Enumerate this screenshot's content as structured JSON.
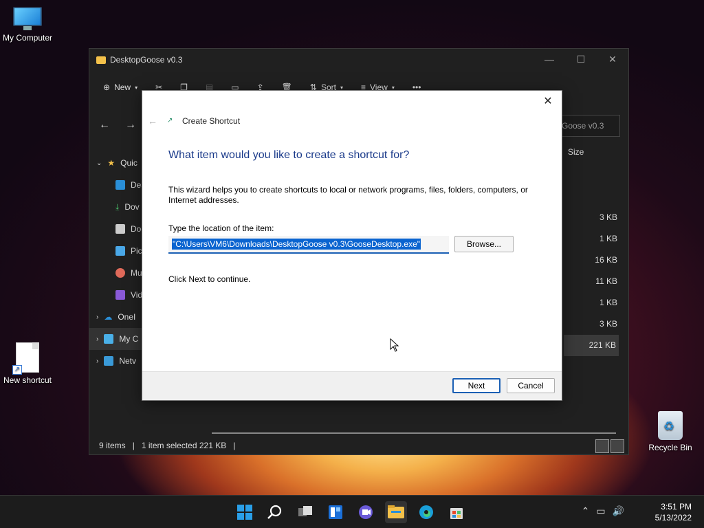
{
  "desktop": {
    "icons": [
      {
        "label": "My Computer"
      },
      {
        "label": "New shortcut"
      },
      {
        "label": "Recycle Bin"
      }
    ]
  },
  "explorer": {
    "title": "DesktopGoose v0.3",
    "toolbar": {
      "new_label": "New",
      "sort_label": "Sort",
      "view_label": "View",
      "more_label": "•••"
    },
    "search_text": "Goose v0.3",
    "sidebar": [
      {
        "label": "Quic"
      },
      {
        "label": "Des"
      },
      {
        "label": "Dov"
      },
      {
        "label": "Doc"
      },
      {
        "label": "Pic"
      },
      {
        "label": "Mu"
      },
      {
        "label": "Vid"
      },
      {
        "label": "OneI"
      },
      {
        "label": "My C"
      },
      {
        "label": "Netv"
      }
    ],
    "column_size": "Size",
    "sizes": [
      "3 KB",
      "1 KB",
      "16 KB",
      "11 KB",
      "1 KB",
      "3 KB",
      "221 KB"
    ],
    "status": {
      "items": "9 items",
      "selected": "1 item selected  221 KB",
      "sep": "|"
    }
  },
  "dialog": {
    "title": "Create Shortcut",
    "heading": "What item would you like to create a shortcut for?",
    "description": "This wizard helps you to create shortcuts to local or network programs, files, folders, computers, or Internet addresses.",
    "location_label": "Type the location of the item:",
    "location_value": "\"C:\\Users\\VM6\\Downloads\\DesktopGoose v0.3\\GooseDesktop.exe\"",
    "browse_label": "Browse...",
    "continue_text": "Click Next to continue.",
    "next_label": "Next",
    "cancel_label": "Cancel"
  },
  "taskbar": {
    "time": "3:51 PM",
    "date": "5/13/2022"
  },
  "colors": {
    "accent": "#1a5fb4",
    "heading": "#1a3a8a",
    "selection": "#0a64d0"
  }
}
